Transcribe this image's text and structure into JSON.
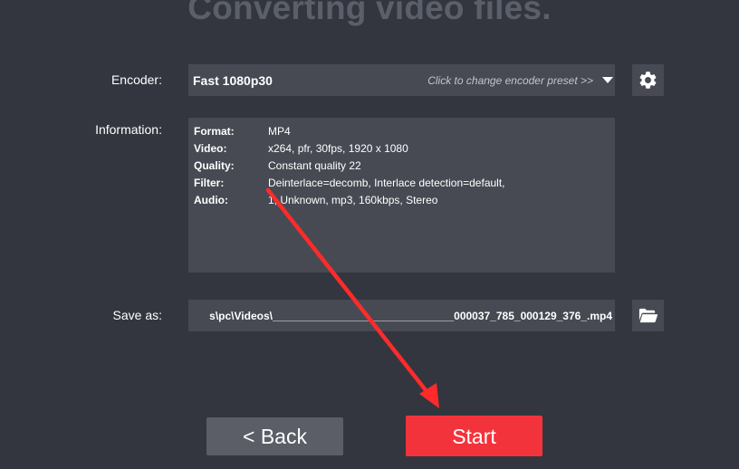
{
  "header": {
    "title": "Converting video files."
  },
  "encoder": {
    "label": "Encoder:",
    "value": "Fast 1080p30",
    "hint": "Click to change encoder preset >>"
  },
  "information": {
    "label": "Information:",
    "rows": [
      {
        "key": "Format:",
        "value": "MP4"
      },
      {
        "key": "Video:",
        "value": "x264, pfr, 30fps, 1920 x 1080"
      },
      {
        "key": "Quality:",
        "value": "Constant quality 22"
      },
      {
        "key": "Filter:",
        "value": "Deinterlace=decomb, Interlace detection=default,"
      },
      {
        "key": "Audio:",
        "value": "1, Unknown, mp3, 160kbps, Stereo"
      }
    ]
  },
  "save_as": {
    "label": "Save as:",
    "value": "s\\pc\\Videos\\______________________________000037_785_000129_376_.mp4"
  },
  "buttons": {
    "back_label": "<  Back",
    "start_label": "Start"
  },
  "icons": {
    "settings": "gear-icon",
    "folder": "folder-open-icon",
    "dropdown": "chevron-down-icon"
  },
  "colors": {
    "background": "#33363f",
    "field": "#474a53",
    "start": "#f3333c",
    "back": "#5b5e67",
    "annotation_arrow": "#ff2b2b"
  }
}
